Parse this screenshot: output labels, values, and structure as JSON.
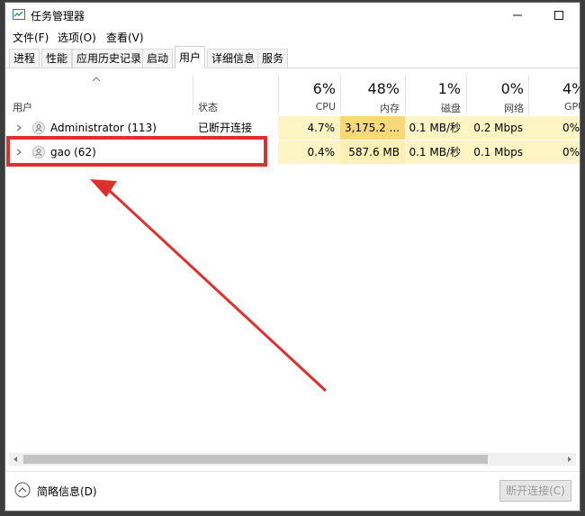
{
  "window": {
    "title": "任务管理器",
    "controls": [
      "minimize-icon",
      "maximize-icon",
      "close-icon"
    ]
  },
  "menu": [
    "文件(F)",
    "选项(O)",
    "查看(V)"
  ],
  "tabs": [
    "进程",
    "性能",
    "应用历史记录",
    "启动",
    "用户",
    "详细信息",
    "服务"
  ],
  "active_tab": "用户",
  "header": {
    "user_label": "用户",
    "status_label": "状态",
    "columns": [
      {
        "percent": "6%",
        "name": "CPU"
      },
      {
        "percent": "48%",
        "name": "内存"
      },
      {
        "percent": "1%",
        "name": "磁盘"
      },
      {
        "percent": "0%",
        "name": "网络"
      },
      {
        "percent": "4%",
        "name": "GPU"
      }
    ]
  },
  "rows": [
    {
      "user": "Administrator (113)",
      "status": "已断开连接",
      "cpu": "4.7%",
      "memory": "3,175.2 ...",
      "disk": "0.1 MB/秒",
      "network": "0.2 Mbps",
      "gpu": "0%"
    },
    {
      "user": "gao (62)",
      "status": "",
      "cpu": "0.4%",
      "memory": "587.6 MB",
      "disk": "0.1 MB/秒",
      "network": "0.1 Mbps",
      "gpu": "0%"
    }
  ],
  "footer": {
    "fewer_details": "简略信息(D)",
    "disconnect": "断开连接(C)"
  },
  "colors": {
    "cpu_cell": "#fff4c4",
    "memory_cell_high": "#f9d87a",
    "memory_cell": "#fff0b3",
    "annotation": "#e0302e"
  }
}
